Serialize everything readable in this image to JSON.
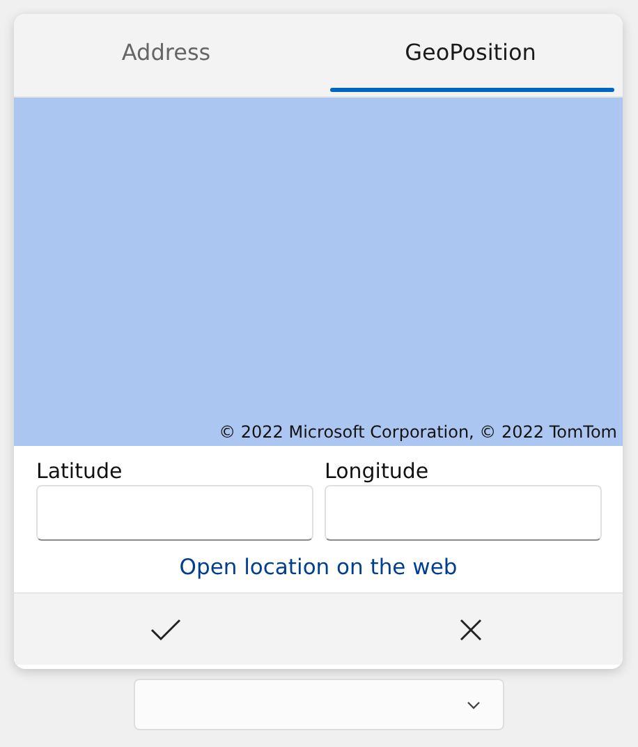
{
  "tabs": [
    {
      "label": "Address",
      "selected": false
    },
    {
      "label": "GeoPosition",
      "selected": true
    }
  ],
  "map": {
    "attribution": "© 2022 Microsoft Corporation, © 2022 TomTom"
  },
  "fields": [
    {
      "label": "Latitude"
    },
    {
      "label": "Longitude"
    }
  ],
  "link": "Open location on the web"
}
